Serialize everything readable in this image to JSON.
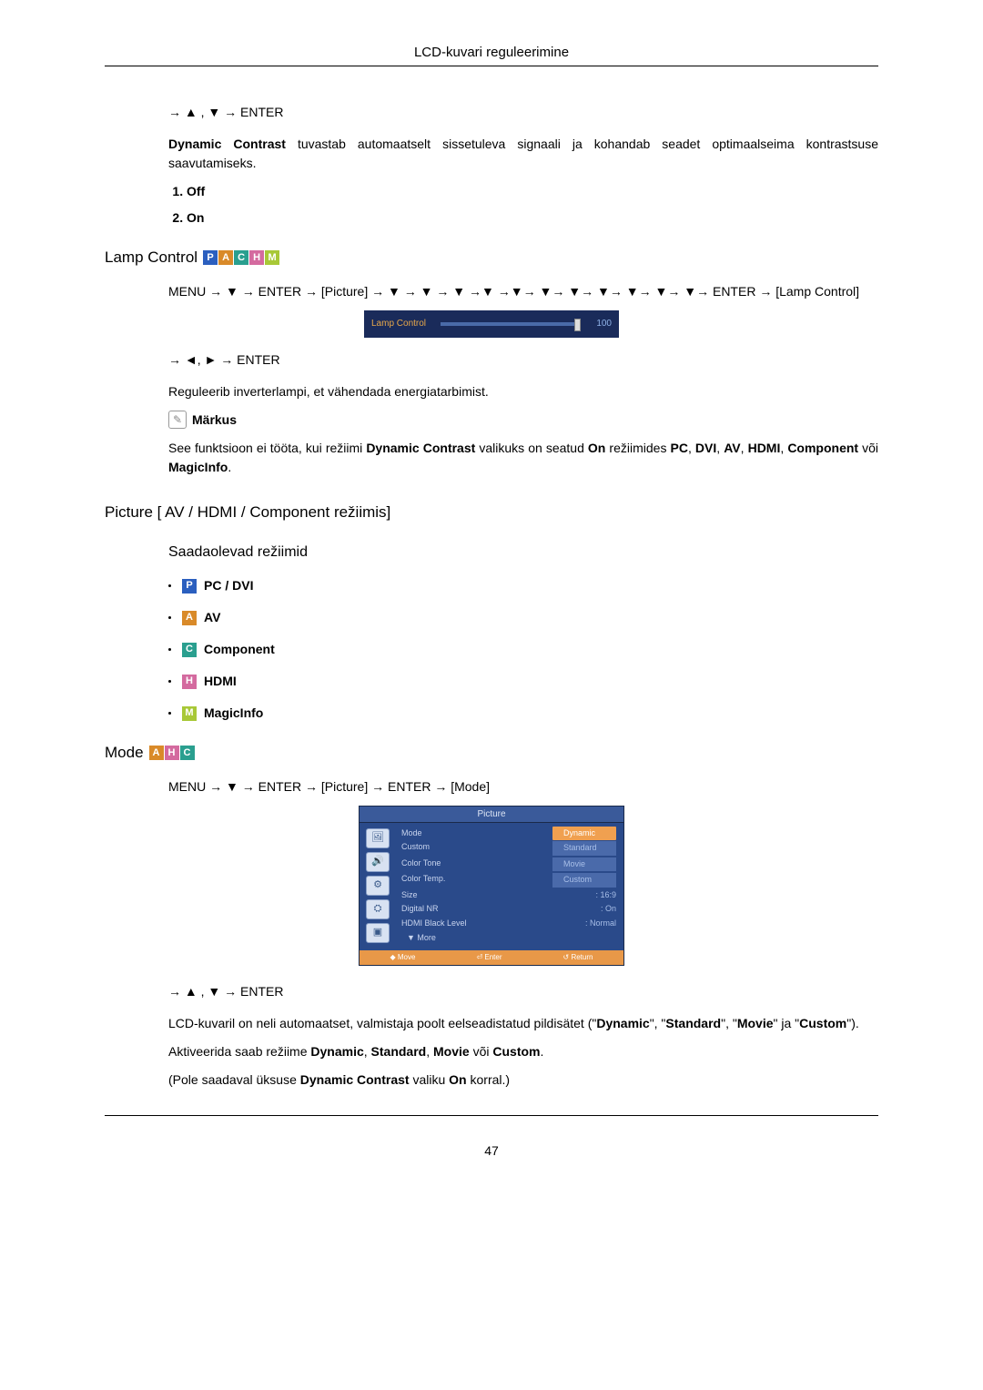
{
  "header": {
    "title": "LCD-kuvari reguleerimine"
  },
  "nav1": "→ ▲ , ▼ → ENTER",
  "dynamic_contrast_para": "Dynamic Contrast tuvastab automaatselt sissetuleva signaali ja kohandab seadet optimaalseima kontrastsuse saavutamiseks.",
  "off_on": {
    "1": "Off",
    "2": "On"
  },
  "lamp_control": {
    "title": "Lamp Control",
    "badges": [
      "P",
      "A",
      "C",
      "H",
      "M"
    ],
    "menu_path": "MENU → ▼ → ENTER → [Picture] → ▼ → ▼ → ▼ →▼ →▼→ ▼→ ▼→ ▼→ ▼→ ▼→ ▼→ ENTER → [Lamp Control]",
    "nav2": "→ ◄, ► → ENTER",
    "desc": "Reguleerib inverterlampi, et vähendada energiatarbimist.",
    "note_label": "Märkus",
    "note_text_parts": [
      "See funktsioon ei tööta, kui režiimi ",
      "Dynamic Contrast",
      " valikuks on seatud ",
      "On",
      " režiimides ",
      "PC",
      ", ",
      "DVI",
      ", ",
      "AV",
      ", ",
      "HDMI",
      ", ",
      "Component",
      " või ",
      "MagicInfo",
      "."
    ]
  },
  "osd_bar": {
    "label": "Lamp Control",
    "value": "100"
  },
  "picture_section": {
    "title": "Picture [ AV / HDMI / Component režiimis]",
    "subtitle": "Saadaolevad režiimid",
    "modes": [
      {
        "badge": "P",
        "class": "b-P",
        "label": "PC / DVI"
      },
      {
        "badge": "A",
        "class": "b-A",
        "label": "AV"
      },
      {
        "badge": "C",
        "class": "b-C",
        "label": "Component"
      },
      {
        "badge": "H",
        "class": "b-H",
        "label": "HDMI"
      },
      {
        "badge": "M",
        "class": "b-M",
        "label": "MagicInfo"
      }
    ]
  },
  "mode_section": {
    "title": "Mode",
    "badges": [
      "A",
      "H",
      "C"
    ],
    "menu_path": "MENU → ▼ → ENTER → [Picture] → ENTER → [Mode]",
    "osd": {
      "title": "Picture",
      "rows": [
        {
          "lbl": "Mode",
          "val": "Dynamic",
          "hl": true
        },
        {
          "lbl": "Custom",
          "val": "Standard",
          "box": true
        },
        {
          "lbl": "Color Tone",
          "val": "Movie",
          "box": true
        },
        {
          "lbl": "Color Temp.",
          "val": "Custom",
          "box": true
        },
        {
          "lbl": "Size",
          "val": ": 16:9"
        },
        {
          "lbl": "Digital NR",
          "val": ": On"
        },
        {
          "lbl": "HDMI Black Level",
          "val": ": Normal",
          "dim": true
        }
      ],
      "more": "▼  More",
      "footer": [
        "◆ Move",
        "⏎ Enter",
        "↺ Return"
      ]
    },
    "nav3": "→ ▲ , ▼ → ENTER",
    "desc1_parts": [
      "LCD-kuvaril on neli automaatset, valmistaja poolt eelseadistatud pildisätet (\"",
      "Dynamic",
      "\", \"",
      "Standard",
      "\", \"",
      "Movie",
      "\" ja \"",
      "Custom",
      "\")."
    ],
    "desc2_parts": [
      "Aktiveerida saab režiime  ",
      "Dynamic",
      ", ",
      "Standard",
      ", ",
      "Movie",
      " või ",
      "Custom",
      "."
    ],
    "desc3_parts": [
      "(Pole saadaval üksuse ",
      "Dynamic Contrast",
      " valiku ",
      "On",
      " korral.)"
    ]
  },
  "page_number": "47"
}
